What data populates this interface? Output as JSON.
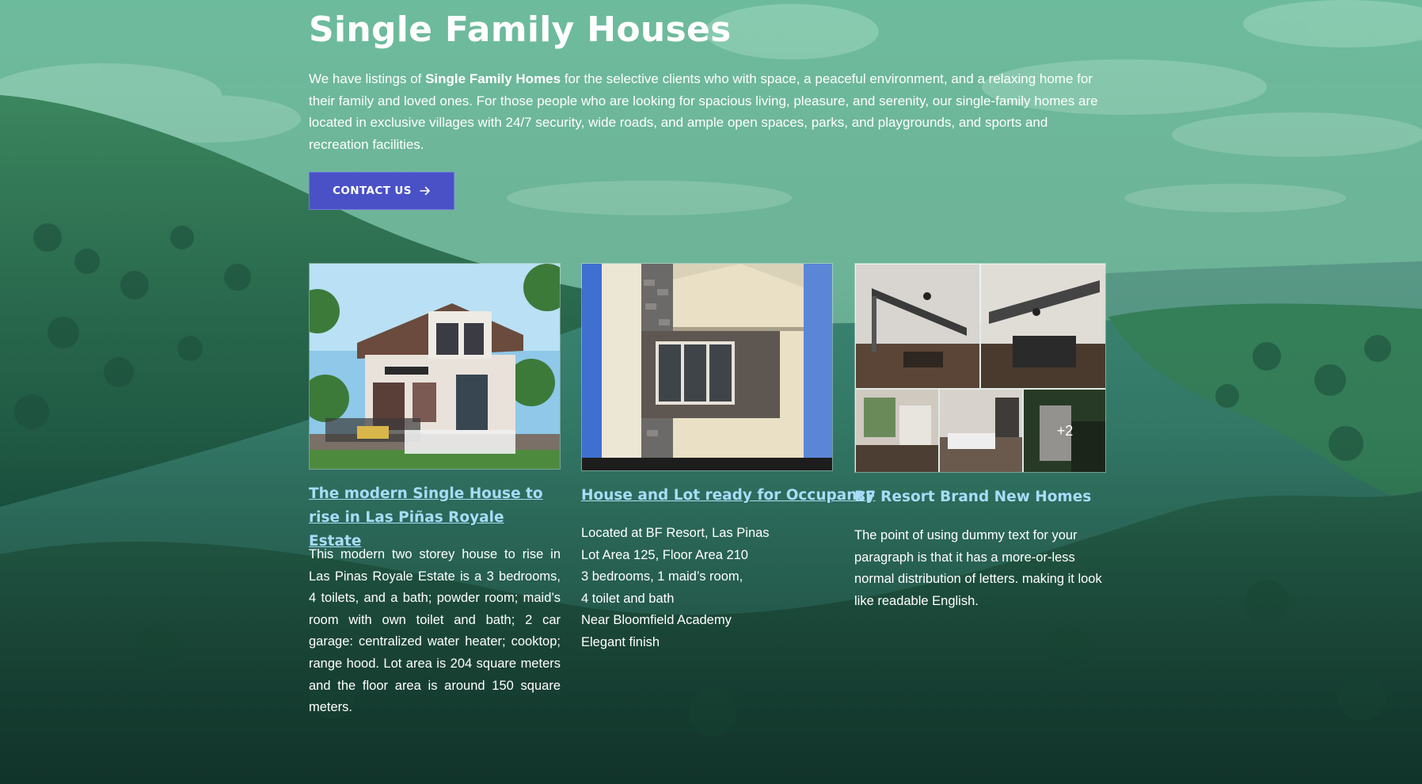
{
  "header": {
    "title": "Single Family Houses",
    "intro_before": "We have listings of ",
    "intro_bold": "Single Family Homes",
    "intro_after": " for the selective clients who with space, a peaceful environment, and a relaxing home for their family and loved ones. For those people who are looking for spacious living, pleasure, and serenity, our single-family homes are located in exclusive villages with 24/7 security, wide roads, and ample open spaces, parks, and playgrounds, and sports and recreation facilities.",
    "contact_label": "CONTACT US"
  },
  "listings": [
    {
      "title": "The modern Single House to rise in Las Piñas Royale Estate",
      "body": "This modern two storey house to rise in Las Pinas Royale Estate is a 3 bedrooms, 4 toilets, and a bath; powder room; maid’s room with own toilet and bath; 2 car garage: centralized water heater; cooktop; range hood. Lot area is 204 square meters and the floor area is around 150 square meters."
    },
    {
      "title": "House and Lot ready for Occupancy",
      "lines": [
        "Located at BF Resort, Las Pinas",
        "Lot Area 125, Floor Area 210",
        "3 bedrooms, 1 maid’s room,",
        "4 toilet and bath",
        "Near Bloomfield Academy",
        "Elegant finish"
      ]
    },
    {
      "title": "BF Resort Brand New Homes",
      "body": "The point of using dummy text for your paragraph is that it has a more-or-less normal distribution of letters. making it look like readable English.",
      "more_count": "+2"
    }
  ],
  "colors": {
    "accent_button": "#4a51c6",
    "link_color": "#a8dcf8"
  },
  "icons": {
    "contact_arrow": "arrow-right-icon"
  }
}
